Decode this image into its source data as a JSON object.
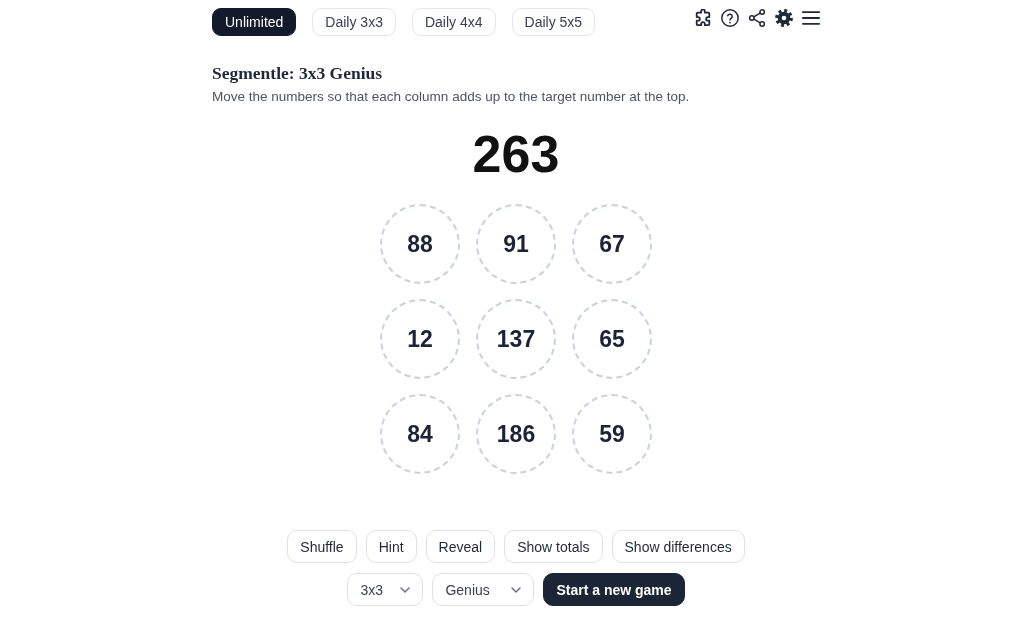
{
  "mode_tabs": [
    {
      "label": "Unlimited",
      "selected": true
    },
    {
      "label": "Daily 3x3",
      "selected": false
    },
    {
      "label": "Daily 4x4",
      "selected": false
    },
    {
      "label": "Daily 5x5",
      "selected": false
    }
  ],
  "puzzle": {
    "title": "Segmentle: 3x3 Genius",
    "instructions": "Move the numbers so that each column adds up to the target number at the top.",
    "target": "263",
    "grid": [
      [
        "88",
        "91",
        "67"
      ],
      [
        "12",
        "137",
        "65"
      ],
      [
        "84",
        "186",
        "59"
      ]
    ]
  },
  "actions": [
    "Shuffle",
    "Hint",
    "Reveal",
    "Show totals",
    "Show differences"
  ],
  "size_dropdown": {
    "value": "3x3"
  },
  "difficulty_dropdown": {
    "value": "Genius"
  },
  "new_game_button": "Start a new game"
}
